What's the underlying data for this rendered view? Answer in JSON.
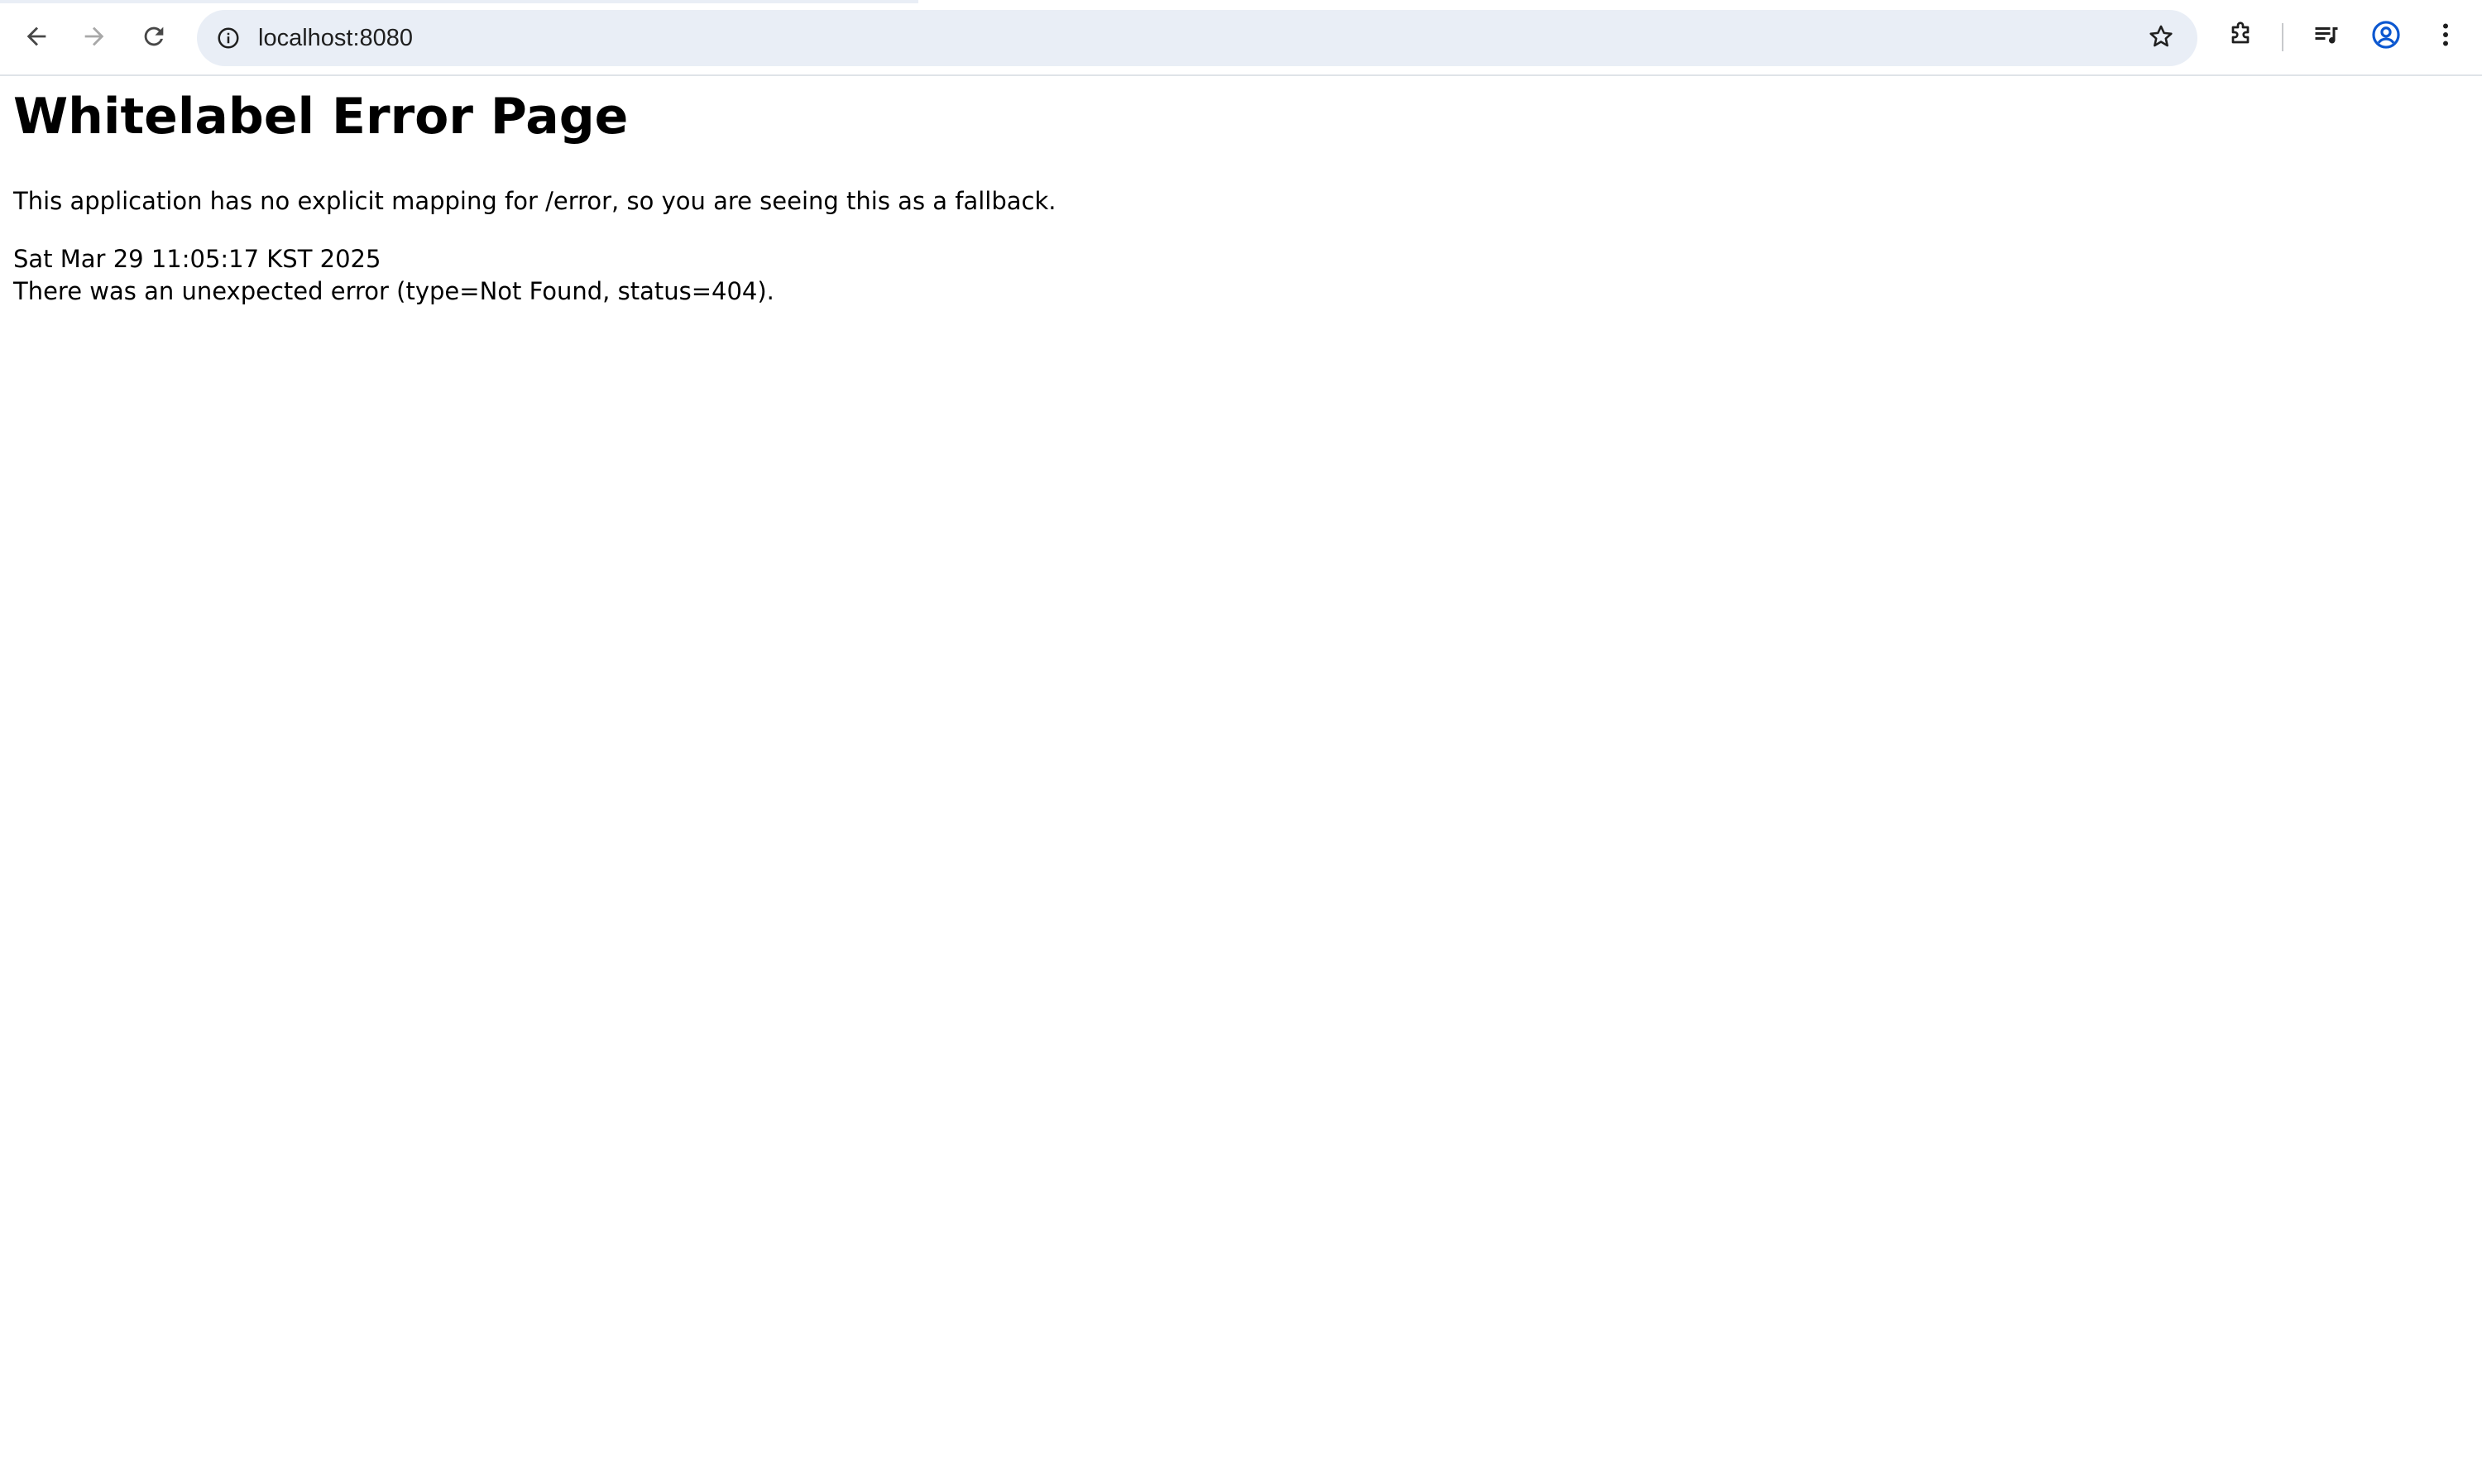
{
  "browser": {
    "url": "localhost:8080",
    "icons": {
      "back": "arrow-left-icon",
      "forward": "arrow-right-icon",
      "reload": "reload-icon",
      "site_info": "info-icon",
      "bookmark": "star-icon",
      "extensions": "puzzle-icon",
      "media": "media-queue-icon",
      "profile": "account-circle-icon",
      "menu": "kebab-menu-icon"
    },
    "colors": {
      "omnibox_bg": "#e9eef6",
      "profile_accent": "#0b57d0"
    }
  },
  "page": {
    "title": "Whitelabel Error Page",
    "description": "This application has no explicit mapping for /error, so you are seeing this as a fallback.",
    "timestamp": "Sat Mar 29 11:05:17 KST 2025",
    "error_message": "There was an unexpected error (type=Not Found, status=404)."
  }
}
